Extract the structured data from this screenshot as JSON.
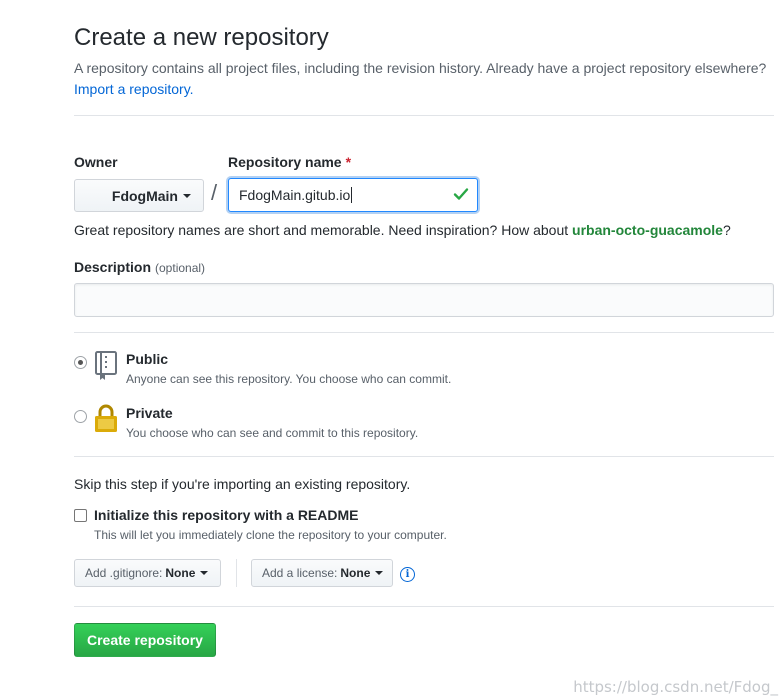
{
  "header": {
    "title": "Create a new repository",
    "subtitle": "A repository contains all project files, including the revision history. Already have a project repository elsewhere?",
    "import_link": "Import a repository."
  },
  "owner": {
    "label": "Owner",
    "value": "FdogMain"
  },
  "repo_name": {
    "label": "Repository name",
    "required_mark": "*",
    "value": "FdogMain.gitub.io",
    "slash": "/"
  },
  "hint": {
    "prefix": "Great repository names are short and memorable. Need inspiration? How about ",
    "suggestion": "urban-octo-guacamole",
    "suffix": "?"
  },
  "description": {
    "label": "Description",
    "optional": "(optional)",
    "value": ""
  },
  "visibility": {
    "public": {
      "title": "Public",
      "note": "Anyone can see this repository. You choose who can commit.",
      "selected": true
    },
    "private": {
      "title": "Private",
      "note": "You choose who can see and commit to this repository.",
      "selected": false
    }
  },
  "init": {
    "skip_text": "Skip this step if you're importing an existing repository.",
    "readme_label": "Initialize this repository with a README",
    "readme_note": "This will let you immediately clone the repository to your computer.",
    "readme_checked": false
  },
  "gitignore": {
    "label": "Add .gitignore:",
    "value": "None"
  },
  "license": {
    "label": "Add a license:",
    "value": "None"
  },
  "create_button": "Create repository",
  "watermark": "https://blog.csdn.net/Fdog_",
  "colors": {
    "accent": "#0366d6",
    "success": "#28a745",
    "suggestion": "#22863a",
    "required": "#cb2431"
  }
}
